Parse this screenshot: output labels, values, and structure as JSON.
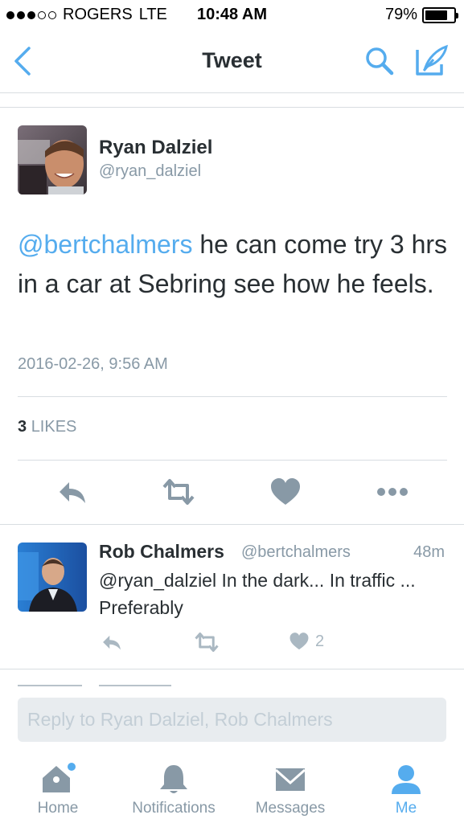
{
  "status_bar": {
    "carrier": "ROGERS",
    "network": "LTE",
    "time": "10:48 AM",
    "battery_percent": "79%",
    "battery_level": 0.79,
    "signal_bars": 3,
    "signal_total": 5
  },
  "nav": {
    "title": "Tweet",
    "back_icon": "chevron-left-icon",
    "search_icon": "search-icon",
    "compose_icon": "compose-icon"
  },
  "tweet": {
    "author_name": "Ryan Dalziel",
    "author_handle": "@ryan_dalziel",
    "mention": "@bertchalmers",
    "text": " he can come try 3 hrs in a car at Sebring see how he feels.",
    "timestamp": "2016-02-26, 9:56 AM",
    "likes_count": "3",
    "likes_label": "LIKES"
  },
  "reply": {
    "author_name": "Rob Chalmers",
    "author_handle": "@bertchalmers",
    "age": "48m",
    "text": "@ryan_dalziel In the dark... In traffic ... Preferably",
    "like_count": "2"
  },
  "composer": {
    "placeholder": "Reply to Ryan Dalziel, Rob Chalmers"
  },
  "tabbar": {
    "tabs": [
      {
        "label": "Home",
        "icon": "home-icon"
      },
      {
        "label": "Notifications",
        "icon": "bell-icon"
      },
      {
        "label": "Messages",
        "icon": "envelope-icon"
      },
      {
        "label": "Me",
        "icon": "person-icon"
      }
    ],
    "active": "Me"
  },
  "colors": {
    "accent": "#55acee",
    "muted": "#8899a6",
    "text": "#292f33",
    "divider": "#d8dde1",
    "input_bg": "#e8ecef"
  }
}
